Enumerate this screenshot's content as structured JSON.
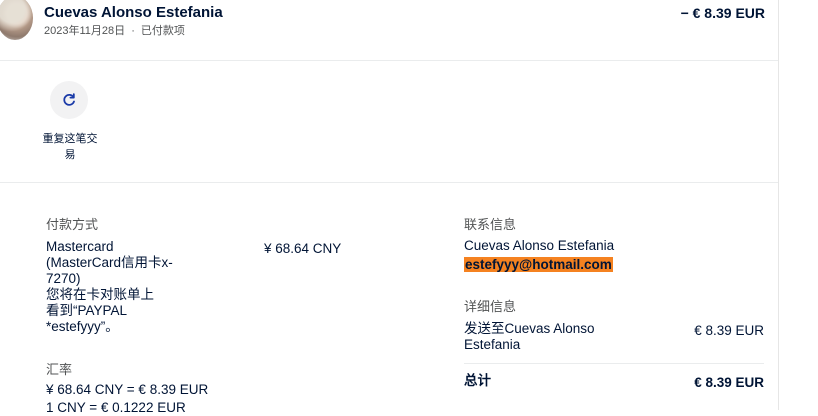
{
  "header": {
    "name": "Cuevas Alonso Estefania",
    "date": "2023年11月28日",
    "separator": "·",
    "status": "已付款项",
    "amount": "− € 8.39 EUR"
  },
  "actions": {
    "repeat_label": "重复这笔交易",
    "repeat_icon": "refresh-icon"
  },
  "payment": {
    "title": "付款方式",
    "method_lines": [
      "Mastercard",
      "(MasterCard信用卡x-",
      "7270)",
      "您将在卡对账单上",
      "看到“PAYPAL",
      "*estefyyy”。"
    ],
    "amount": "¥ 68.64 CNY"
  },
  "exchange": {
    "title": "汇率",
    "line1": "¥ 68.64 CNY = € 8.39 EUR",
    "line2": "1 CNY = € 0.1222 EUR"
  },
  "contact": {
    "title": "联系信息",
    "name": "Cuevas Alonso Estefania",
    "email": "estefyyy@hotmail.com"
  },
  "details": {
    "title": "详细信息",
    "sent_to_line1": "发送至Cuevas Alonso",
    "sent_to_line2": "Estefania",
    "sent_amount": "€ 8.39 EUR",
    "total_label": "总计",
    "total_amount": "€ 8.39 EUR"
  },
  "colors": {
    "text": "#001435",
    "muted": "#515354",
    "highlight": "#f58220",
    "icon": "#1a3aa8"
  }
}
